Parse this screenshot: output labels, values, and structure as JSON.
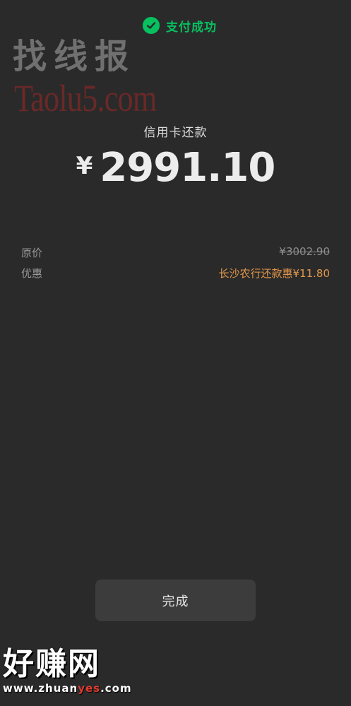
{
  "header": {
    "status_text": "支付成功",
    "status_icon": "wechat-pay-icon",
    "accent_color": "#07c160"
  },
  "payment": {
    "type": "信用卡还款",
    "currency_symbol": "¥",
    "amount": "2991.10"
  },
  "details": {
    "original_label": "原价",
    "original_value": "¥3002.90",
    "discount_label": "优惠",
    "discount_value": "长沙农行还款惠¥11.80",
    "discount_color": "#e3974a"
  },
  "actions": {
    "done_label": "完成"
  },
  "watermarks": {
    "top_cn": "找线报",
    "top_en": "Taolu5.com",
    "bottom_cn": "好赚网",
    "bottom_url_prefix": "www.zhuan",
    "bottom_url_highlight": "yes",
    "bottom_url_suffix": ".com"
  }
}
